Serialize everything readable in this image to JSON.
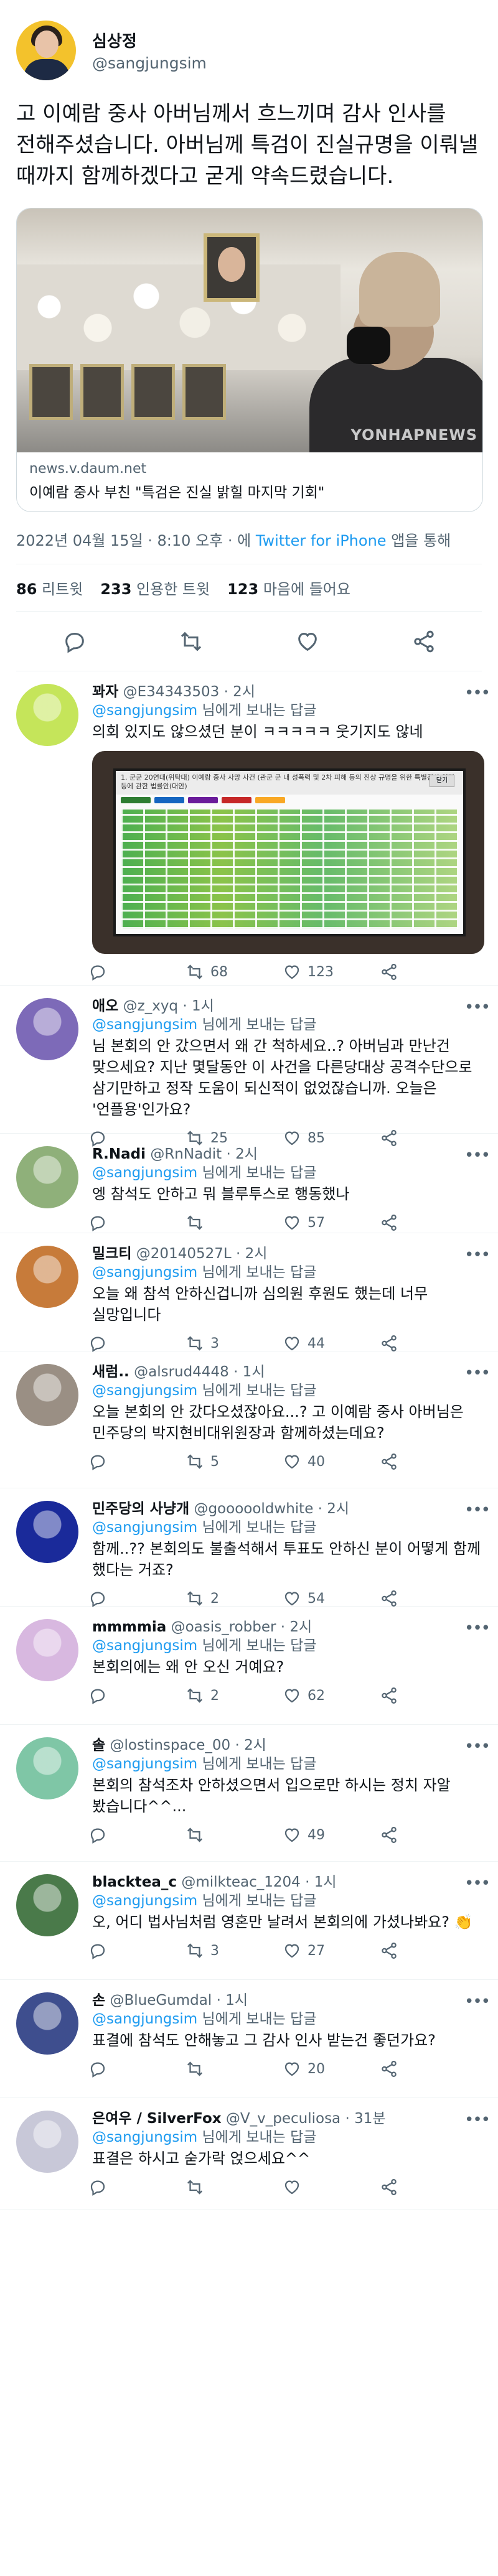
{
  "main_tweet": {
    "name": "심상정",
    "handle": "@sangjungsim",
    "text": "고 이예람 중사 아버님께서 흐느끼며 감사 인사를 전해주셨습니다. 아버님께 특검이 진실규명을 이뤄낼 때까지 함께하겠다고 굳게 약속드렸습니다.",
    "card": {
      "domain": "news.v.daum.net",
      "title": "이예람 중사 부친 \"특검은 진실 밝힐 마지막 기회\"",
      "watermark": "YONHAPNEWS"
    },
    "date": "2022년 04월 15일 · 8:10 오후 · 에",
    "app": "Twitter for iPhone",
    "app_suffix": "앱을 통해",
    "stats": {
      "retweets": "86",
      "retweets_label": "리트윗",
      "quotes": "233",
      "quotes_label": "인용한 트윗",
      "likes": "123",
      "likes_label": "마음에 들어요"
    }
  },
  "reply_to_prefix": "@sangjungsim",
  "reply_to_suffix": "님에게 보내는 답글",
  "replies": [
    {
      "name": "꽈자",
      "handle": "@E34343503",
      "time": "· 2시",
      "text": "의회 있지도 않으셨던 분이 ㅋㅋㅋㅋㅋ 웃기지도 않네",
      "reply": "",
      "retweet": "68",
      "like": "123"
    },
    {
      "name": "애오",
      "handle": "@z_xyq",
      "time": "· 1시",
      "text": "님 본회의 안 갔으면서 왜 간 척하세요..? 아버님과 만난건 맞으세요? 지난 몇달동안 이 사건을 다른당대상 공격수단으로 삼기만하고 정작 도움이 되신적이 없었잖습니까. 오늘은 '언플용'인가요?",
      "reply": "",
      "retweet": "25",
      "like": "85"
    },
    {
      "name": "R.Nadi",
      "handle": "@RnNadit",
      "time": "· 2시",
      "text": "엥 참석도 안하고 뭐 블루투스로 행동했나",
      "reply": "",
      "retweet": "",
      "like": "57"
    },
    {
      "name": "밀크티",
      "handle": "@20140527L",
      "time": "· 2시",
      "text": "오늘 왜 참석 안하신겁니까 심의원 후원도 했는데 너무 실망입니다",
      "reply": "",
      "retweet": "3",
      "like": "44"
    },
    {
      "name": "새럼..",
      "handle": "@alsrud4448",
      "time": "· 1시",
      "text": "오늘 본회의 안 갔다오셨잖아요...? 고 이예람 중사 아버님은 민주당의 박지현비대위원장과 함께하셨는데요?",
      "reply": "",
      "retweet": "5",
      "like": "40"
    },
    {
      "name": "민주당의 사냥개",
      "handle": "@goooooldwhite",
      "time": "· 2시",
      "text": "함께..?? 본회의도 불출석해서 투표도 안하신 분이 어떻게 함께 했다는 거죠?",
      "reply": "",
      "retweet": "2",
      "like": "54"
    },
    {
      "name": "mmmmia",
      "handle": "@oasis_robber",
      "time": "· 2시",
      "text": "본회의에는 왜 안 오신 거예요?",
      "reply": "",
      "retweet": "2",
      "like": "62"
    },
    {
      "name": "솔",
      "handle": "@lostinspace_00",
      "time": "· 2시",
      "text": "본회의 참석조차 안하셨으면서 입으로만 하시는 정치 자알 봤습니다^^...",
      "reply": "",
      "retweet": "",
      "like": "49"
    },
    {
      "name": "blacktea_c",
      "handle": "@milkteac_1204",
      "time": "· 1시",
      "text": "오, 어디 법사님처럼 영혼만 날려서 본회의에 가셨나봐요? 👏",
      "reply": "",
      "retweet": "3",
      "like": "27"
    },
    {
      "name": "손",
      "handle": "@BlueGumdal",
      "time": "· 1시",
      "text": "표결에 참석도 안해놓고 그 감사 인사 받는건 좋던가요?",
      "reply": "",
      "retweet": "",
      "like": "20"
    },
    {
      "name": "은여우 / SilverFox",
      "handle": "@V_v_peculiosa",
      "time": "· 31분",
      "text": "표결은 하시고 숟가락 얹으세요^^",
      "reply": "",
      "retweet": "",
      "like": ""
    }
  ],
  "media_header": "1. 군군 20연대(위탁대) 이예람 중사 사망 사건 (관군 군 내 성폭력 및 2차 피해 등의 진상 규명을 위한 특별검사 임명 등에 관한 법률안(대안)",
  "media_button": "닫기"
}
